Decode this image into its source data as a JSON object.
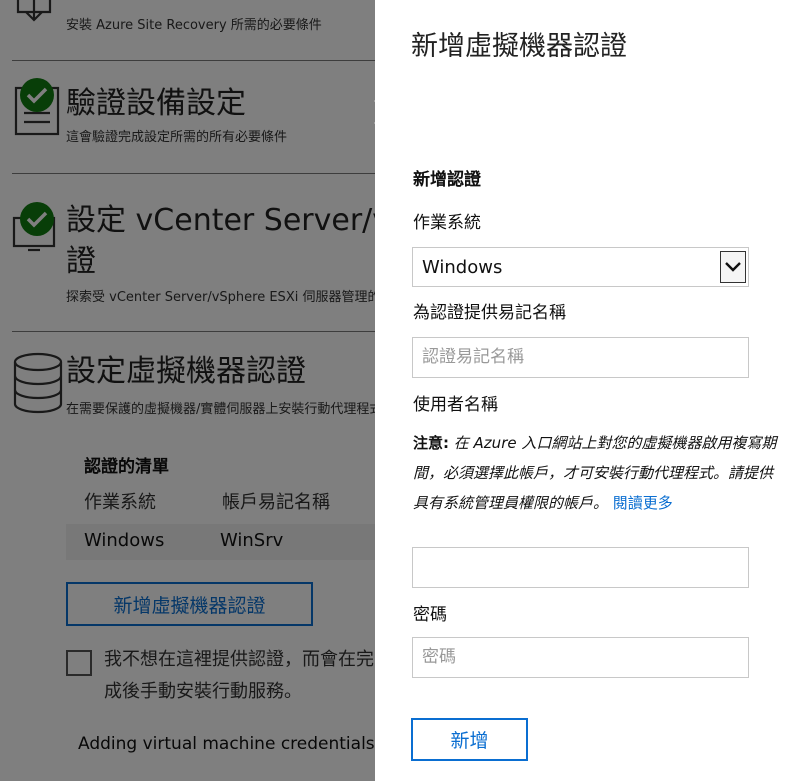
{
  "background_wizard": {
    "step_install": {
      "subtitle": "安裝 Azure Site Recovery 所需的必要條件"
    },
    "step_verify": {
      "title": "驗證設備設定",
      "subtitle": "這會驗證完成設定所需的所有必要條件"
    },
    "step_vcenter": {
      "title_line1": "設定 vCenter Server/vSphere ESXi 認",
      "title_line2": "證",
      "subtitle": "探索受 vCenter Server/vSphere ESXi 伺服器管理的虛擬機器"
    },
    "step_vm_creds": {
      "title": "設定虛擬機器認證",
      "subtitle": "在需要保護的虛擬機器/實體伺服器上安裝行動代理程式"
    },
    "credential_list": {
      "heading": "認證的清單",
      "columns": [
        "作業系統",
        "帳戶易記名稱"
      ],
      "rows": [
        {
          "os": "Windows",
          "account": "WinSrv"
        }
      ]
    },
    "add_vm_credential_button": "新增虛擬機器認證",
    "optout_checkbox_label": "我不想在這裡提供認證，而會在完成後手動安裝行動服務。",
    "status_text": "Adding virtual machine credentials..."
  },
  "panel": {
    "title": "新增虛擬機器認證",
    "section_heading": "新增認證",
    "os_label": "作業系統",
    "os_selected": "Windows",
    "friendly_name_label": "為認證提供易記名稱",
    "friendly_name_placeholder": "認證易記名稱",
    "username_label": "使用者名稱",
    "note_label": "注意:",
    "note_text": "在 Azure 入口網站上對您的虛擬機器啟用複寫期間，必須選擇此帳戶，才可安裝行動代理程式。請提供具有系統管理員權限的帳戶。",
    "note_link": "閱讀更多",
    "username_value": "",
    "password_label": "密碼",
    "password_placeholder": "密碼",
    "add_button": "新增"
  },
  "colors": {
    "accent": "#0a6ed1",
    "success": "#107c10",
    "overlay": "#7f7f7f"
  },
  "icons": [
    "download-icon",
    "checkmark-icon",
    "checklist-icon",
    "monitor-icon",
    "database-icon",
    "close-icon",
    "chevron-down-icon"
  ]
}
